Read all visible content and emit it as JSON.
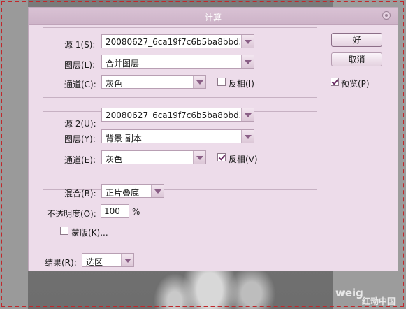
{
  "dialog": {
    "title": "计算",
    "ok_label": "好",
    "cancel_label": "取消",
    "preview_label": "预览(P)",
    "preview_checked": true
  },
  "source1": {
    "label": "源 1(S):",
    "value": "20080627_6ca19f7c6b5ba8bbd3...",
    "layer_label": "图层(L):",
    "layer_value": "合并图层",
    "channel_label": "通道(C):",
    "channel_value": "灰色",
    "invert_label": "反相(I)",
    "invert_checked": false
  },
  "source2": {
    "label": "源 2(U):",
    "value": "20080627_6ca19f7c6b5ba8bbd3...",
    "layer_label": "图层(Y):",
    "layer_value": "背景 副本",
    "channel_label": "通道(E):",
    "channel_value": "灰色",
    "invert_label": "反相(V)",
    "invert_checked": true
  },
  "blending": {
    "mode_label": "混合(B):",
    "mode_value": "正片叠底",
    "opacity_label": "不透明度(O):",
    "opacity_value": "100",
    "opacity_unit": "%",
    "mask_label": "蒙版(K)...",
    "mask_checked": false
  },
  "result": {
    "label": "结果(R):",
    "value": "选区"
  },
  "watermark": {
    "text1": "weig",
    "text2": "红动中国"
  }
}
